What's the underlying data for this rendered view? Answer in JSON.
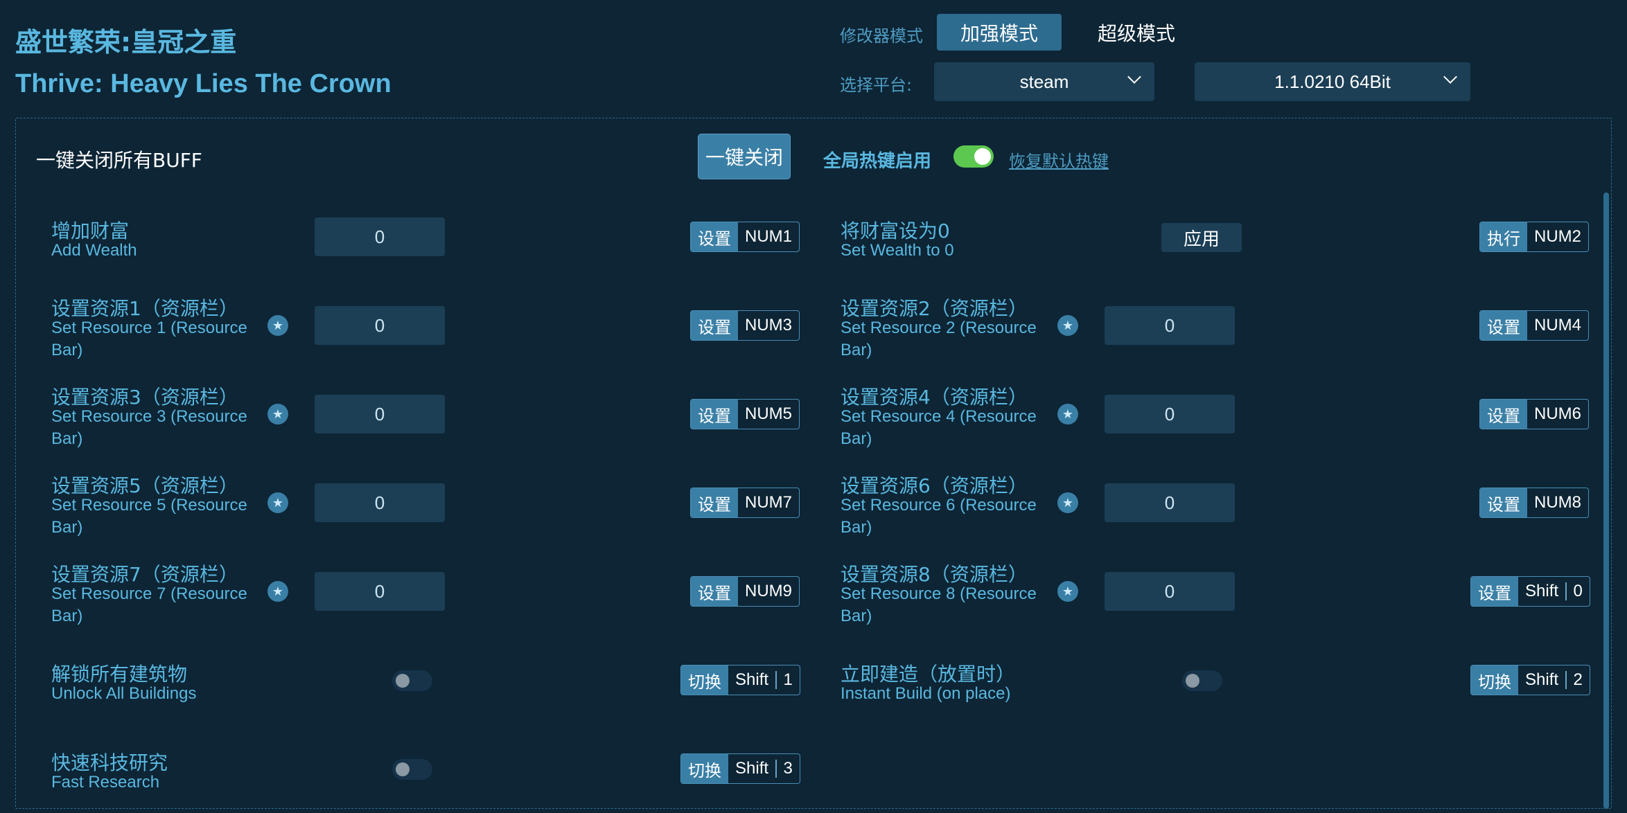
{
  "app": {
    "title_cn": "盛世繁荣:皇冠之重",
    "title_en": "Thrive: Heavy Lies The Crown"
  },
  "mode": {
    "label": "修改器模式",
    "active": "加强模式",
    "other": "超级模式"
  },
  "platform": {
    "label": "选择平台:",
    "value": "steam",
    "version": "1.1.0210 64Bit"
  },
  "top_bar": {
    "close_all_label": "一键关闭所有BUFF",
    "close_all_button": "一键关闭",
    "hotkey_label": "全局热键启用",
    "hotkey_enabled": true,
    "restore_link": "恢复默认热键"
  },
  "items": [
    {
      "cn": "增加财富",
      "en": "Add Wealth",
      "value": "0",
      "action": "设置",
      "keys": [
        "NUM1"
      ]
    },
    {
      "cn": "将财富设为0",
      "en": "Set Wealth to 0",
      "button": "应用",
      "action": "执行",
      "keys": [
        "NUM2"
      ]
    },
    {
      "cn": "设置资源1（资源栏）",
      "en": "Set Resource 1 (Resource Bar)",
      "value": "0",
      "action": "设置",
      "keys": [
        "NUM3"
      ]
    },
    {
      "cn": "设置资源2（资源栏）",
      "en": "Set Resource 2 (Resource Bar)",
      "value": "0",
      "action": "设置",
      "keys": [
        "NUM4"
      ]
    },
    {
      "cn": "设置资源3（资源栏）",
      "en": "Set Resource 3 (Resource Bar)",
      "value": "0",
      "action": "设置",
      "keys": [
        "NUM5"
      ]
    },
    {
      "cn": "设置资源4（资源栏）",
      "en": "Set Resource 4 (Resource Bar)",
      "value": "0",
      "action": "设置",
      "keys": [
        "NUM6"
      ]
    },
    {
      "cn": "设置资源5（资源栏）",
      "en": "Set Resource 5 (Resource Bar)",
      "value": "0",
      "action": "设置",
      "keys": [
        "NUM7"
      ]
    },
    {
      "cn": "设置资源6（资源栏）",
      "en": "Set Resource 6 (Resource Bar)",
      "value": "0",
      "action": "设置",
      "keys": [
        "NUM8"
      ]
    },
    {
      "cn": "设置资源7（资源栏）",
      "en": "Set Resource 7 (Resource Bar)",
      "value": "0",
      "action": "设置",
      "keys": [
        "NUM9"
      ]
    },
    {
      "cn": "设置资源8（资源栏）",
      "en": "Set Resource 8 (Resource Bar)",
      "value": "0",
      "action": "设置",
      "keys": [
        "Shift",
        "0"
      ]
    },
    {
      "cn": "解锁所有建筑物",
      "en": "Unlock All Buildings",
      "toggle": false,
      "action": "切换",
      "keys": [
        "Shift",
        "1"
      ]
    },
    {
      "cn": "立即建造（放置时）",
      "en": "Instant Build (on place)",
      "toggle": false,
      "action": "切换",
      "keys": [
        "Shift",
        "2"
      ]
    },
    {
      "cn": "快速科技研究",
      "en": "Fast Research",
      "toggle": false,
      "action": "切换",
      "keys": [
        "Shift",
        "3"
      ]
    }
  ],
  "colors": {
    "background": "#0d2535",
    "accent": "#5ab8e0",
    "button": "#2d6b8f",
    "toggle_on": "#5cc84f"
  }
}
